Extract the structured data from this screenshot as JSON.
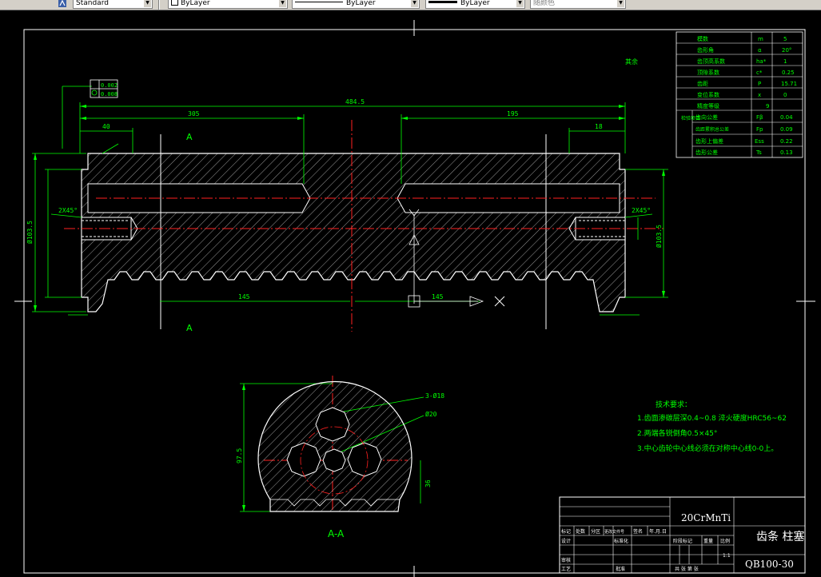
{
  "toolbar": {
    "text_style": "Standard",
    "layer": "ByLayer",
    "linetype": "ByLayer",
    "lineweight": "ByLayer",
    "plot_style": "随颜色"
  },
  "colors": {
    "background": "#000000",
    "outline": "#ffffff",
    "dimension": "#00ff00",
    "centerline": "#ff2020",
    "hatch": "#ffffff"
  },
  "drawing": {
    "section_label_top": "A",
    "section_label_bottom": "A",
    "section_view_label": "A-A",
    "roughness_note": "其余",
    "tolerance_frame": [
      "0.002",
      "0.008"
    ],
    "dims": {
      "overall": "484.5",
      "left_len": "305",
      "right_len": "195",
      "left_end": "40",
      "right_end": "18",
      "rack_len_left": "145",
      "rack_len_right": "145",
      "height_left": "Ø103.5",
      "height_right": "Ø103.5",
      "chamfer_left": "2X45°",
      "chamfer_right": "2X45°",
      "section_height": "97.5",
      "section_small": "36",
      "hole_label": "3-Ø18",
      "center_hole": "Ø20"
    }
  },
  "param_table": [
    {
      "name": "模数",
      "sym": "m",
      "val": "5"
    },
    {
      "name": "齿形角",
      "sym": "α",
      "val": "20°"
    },
    {
      "name": "齿顶高系数",
      "sym": "ha*",
      "val": "1"
    },
    {
      "name": "顶隙系数",
      "sym": "c*",
      "val": "0.25"
    },
    {
      "name": "齿距",
      "sym": "P",
      "val": "15.71"
    },
    {
      "name": "变位系数",
      "sym": "x",
      "val": "0"
    },
    {
      "name": "精度等级",
      "sym": "",
      "val": "9"
    }
  ],
  "check_group": "检验项目",
  "check_table": [
    {
      "name": "齿向公差",
      "sym": "Fβ",
      "val": "0.04"
    },
    {
      "name": "齿距累积总公差",
      "sym": "Fp",
      "val": "0.09"
    },
    {
      "name": "齿形上偏差",
      "sym": "Ess",
      "val": "0.22"
    },
    {
      "name": "齿形公差",
      "sym": "Ts",
      "val": "0.13"
    }
  ],
  "tech_req": {
    "title": "技术要求：",
    "items": [
      "1.齿面渗碳层深0.4~0.8 淬火硬度HRC56~62",
      "2.两端各锐倒角0.5×45°",
      "3.中心齿轮中心线必须在对称中心线0-0上。"
    ]
  },
  "title_block": {
    "material": "20CrMnTi",
    "part_name": "齿条 柱塞",
    "drawing_no": "QB100-30",
    "scale": "1:1",
    "labels": {
      "mark": "标记",
      "count": "处数",
      "zone": "分区",
      "change_doc": "更改文件号",
      "sign": "签名",
      "date": "年.月.日",
      "design": "设计",
      "standardize": "标准化",
      "stage_mark": "阶段标记",
      "weight": "重量",
      "ratio": "比例",
      "review": "审核",
      "process": "工艺",
      "approve": "批准",
      "sheets": "共 张 第 张"
    }
  }
}
